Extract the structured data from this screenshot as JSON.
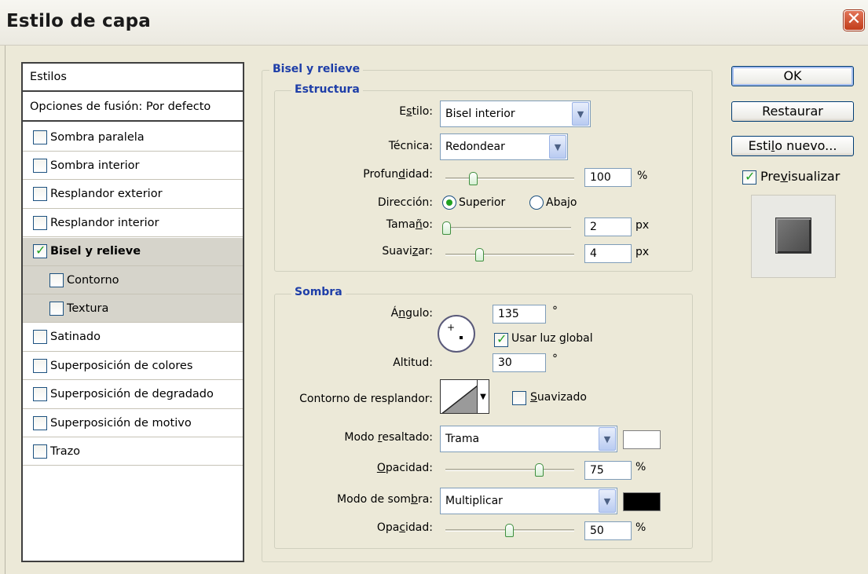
{
  "window": {
    "title": "Estilo de capa",
    "close_glyph": "✕"
  },
  "styles_list": {
    "header": "Estilos",
    "fusion": "Opciones de fusión: Por defecto",
    "items": [
      {
        "label": "Sombra paralela",
        "checked": false
      },
      {
        "label": "Sombra interior",
        "checked": false
      },
      {
        "label": "Resplandor exterior",
        "checked": false
      },
      {
        "label": "Resplandor interior",
        "checked": false
      },
      {
        "label": "Bisel y relieve",
        "checked": true,
        "selected": true
      },
      {
        "label": "Contorno",
        "checked": false
      },
      {
        "label": "Textura",
        "checked": false
      },
      {
        "label": "Satinado",
        "checked": false
      },
      {
        "label": "Superposición de colores",
        "checked": false
      },
      {
        "label": "Superposición de degradado",
        "checked": false
      },
      {
        "label": "Superposición de motivo",
        "checked": false
      },
      {
        "label": "Trazo",
        "checked": false
      }
    ]
  },
  "bevel": {
    "section_title": "Bisel y relieve",
    "structure": {
      "title": "Estructura",
      "estilo_label_pre": "E",
      "estilo_label_u": "s",
      "estilo_label_post": "tilo:",
      "estilo_value": "Bisel interior",
      "tecnica_label": "Técnica:",
      "tecnica_value": "Redondear",
      "profundidad_label_pre": "Profun",
      "profundidad_label_u": "d",
      "profundidad_label_post": "idad:",
      "profundidad_value": "100",
      "profundidad_unit": "%",
      "profundidad_level": 0.2,
      "direccion_label": "Dirección:",
      "direccion_superior": "Superior",
      "direccion_abajo": "Abajo",
      "tamano_label_pre": "Tama",
      "tamano_label_u": "ñ",
      "tamano_label_post": "o:",
      "tamano_value": "2",
      "tamano_unit": "px",
      "tamano_level": 0.0,
      "suavizar_label_pre": "Suavi",
      "suavizar_label_u": "z",
      "suavizar_label_post": "ar:",
      "suavizar_value": "4",
      "suavizar_unit": "px",
      "suavizar_level": 0.25
    },
    "shading": {
      "title": "Sombra",
      "angulo_label_pre": "Á",
      "angulo_label_u": "n",
      "angulo_label_post": "gulo:",
      "angulo_value": "135",
      "degree": "°",
      "usar_luz_pre": "Usar luz ",
      "usar_luz_u": "g",
      "usar_luz_post": "lobal",
      "altitud_label": "Altitud:",
      "altitud_value": "30",
      "contorno_label": "Contorno de resplandor:",
      "suavizado_u": "S",
      "suavizado_post": "uavizado",
      "modo_resaltado_pre": "Modo ",
      "modo_resaltado_u": "r",
      "modo_resaltado_post": "esaltado:",
      "modo_resaltado_value": "Trama",
      "highlight_color": "#ffffff",
      "opacidad1_u": "O",
      "opacidad1_post": "pacidad:",
      "opacidad1_value": "75",
      "opacidad1_unit": "%",
      "opacidad1_level": 0.75,
      "modo_sombra_pre": "Modo de som",
      "modo_sombra_u": "b",
      "modo_sombra_post": "ra:",
      "modo_sombra_value": "Multiplicar",
      "shadow_color": "#000000",
      "opacidad2_pre": "Opa",
      "opacidad2_u": "c",
      "opacidad2_post": "idad:",
      "opacidad2_value": "50",
      "opacidad2_unit": "%",
      "opacidad2_level": 0.5
    }
  },
  "buttons": {
    "ok": "OK",
    "restaurar": "Restaurar",
    "estilo_nuevo_pre": "Esti",
    "estilo_nuevo_u": "l",
    "estilo_nuevo_post": "o nuevo...",
    "preview_pre": "Pre",
    "preview_u": "v",
    "preview_post": "isualizar"
  },
  "icons": {
    "dropdown": "chevron-down-icon",
    "check": "checkmark-icon"
  }
}
